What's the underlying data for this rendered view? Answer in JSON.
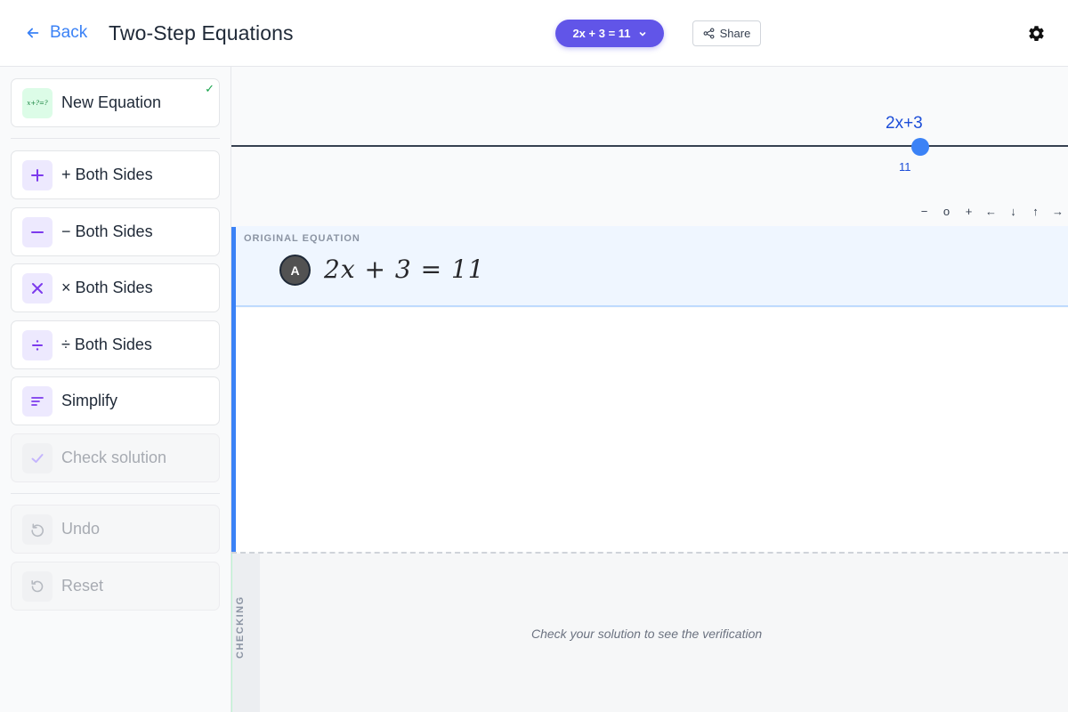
{
  "header": {
    "back_label": "Back",
    "title": "Two-Step Equations",
    "equation_pill": "2x + 3 = 11",
    "share_label": "Share"
  },
  "sidebar": {
    "new_equation": {
      "label": "New Equation",
      "icon_text": "x+?=?",
      "done_mark": "✓"
    },
    "tools": [
      {
        "label": "+ Both Sides",
        "icon": "plus-icon"
      },
      {
        "label": "− Both Sides",
        "icon": "minus-icon"
      },
      {
        "label": "× Both Sides",
        "icon": "multiply-icon"
      },
      {
        "label": "÷ Both Sides",
        "icon": "divide-icon"
      },
      {
        "label": "Simplify",
        "icon": "simplify-icon"
      },
      {
        "label": "Check solution",
        "icon": "check-icon",
        "disabled": true
      }
    ],
    "history": [
      {
        "label": "Undo",
        "icon": "undo-icon",
        "disabled": true
      },
      {
        "label": "Reset",
        "icon": "reset-icon",
        "disabled": true
      }
    ]
  },
  "number_line": {
    "expression_label": "2x+3",
    "value_label": "11"
  },
  "zoom_controls": [
    "−",
    "o",
    "+",
    "←",
    "↓",
    "↑",
    "→"
  ],
  "original_equation": {
    "section_label": "ORIGINAL EQUATION",
    "badge": "A",
    "equation": "2x + 3 = 11"
  },
  "checking": {
    "section_label": "CHECKING",
    "message": "Check your solution to see the verification"
  },
  "colors": {
    "accent": "#6155e8",
    "link": "#3b82f6",
    "icon_purple": "#7c3aed",
    "success": "#16a34a"
  }
}
